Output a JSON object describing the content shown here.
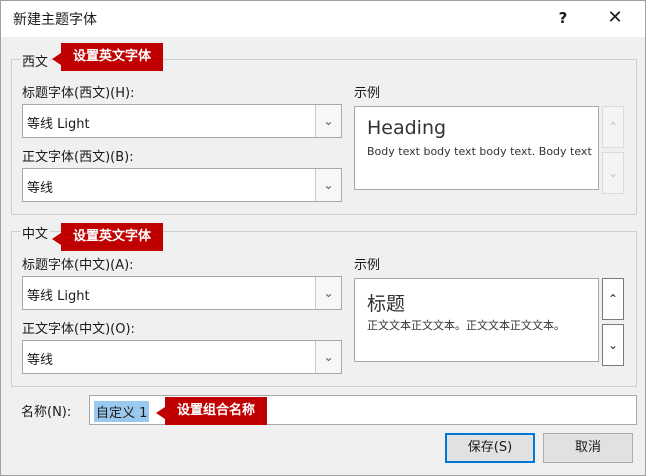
{
  "window": {
    "title": "新建主题字体",
    "help_label": "?",
    "close_label": "✕"
  },
  "western": {
    "group_label": "西文",
    "heading_label": "标题字体(西文)(H):",
    "heading_value": "等线 Light",
    "body_label": "正文字体(西文)(B):",
    "body_value": "等线",
    "sample_label": "示例",
    "sample_heading": "Heading",
    "sample_body": "Body text body text body text. Body text",
    "callout": "设置英文字体"
  },
  "eastasian": {
    "group_label": "中文",
    "heading_label": "标题字体(中文)(A):",
    "heading_value": "等线 Light",
    "body_label": "正文字体(中文)(O):",
    "body_value": "等线",
    "sample_label": "示例",
    "sample_heading": "标题",
    "sample_body": "正文文本正文文本。正文文本正文文本。",
    "callout": "设置英文字体"
  },
  "name": {
    "label": "名称(N):",
    "value": "自定义 1",
    "callout": "设置组合名称"
  },
  "buttons": {
    "save": "保存(S)",
    "cancel": "取消"
  },
  "icons": {
    "dropdown": "chevron-down-icon",
    "scroll_up": "chevron-up-icon",
    "scroll_down": "chevron-down-icon"
  },
  "colors": {
    "callout_bg": "#c00000",
    "selection": "#99c9ef",
    "focus_border": "#0078d7"
  }
}
